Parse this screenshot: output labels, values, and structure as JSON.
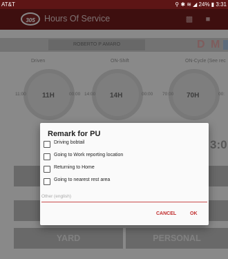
{
  "status_bar": {
    "carrier": "AT&T",
    "system": "⚲ ✱ ≋ ◢ 24% ▮ 3:31"
  },
  "app_bar": {
    "logo_text": "305",
    "title": "Hours Of Service"
  },
  "driver": {
    "name": "ROBERTO P AMARO",
    "status_letters": "D M"
  },
  "gauges": [
    {
      "label": "Driven",
      "value": "11H",
      "left": "11:00",
      "right": "00:00"
    },
    {
      "label": "ON-Shift",
      "value": "14H",
      "left": "14:00",
      "right": "00:00"
    },
    {
      "label": "ON-Cycle (See rec",
      "value": "70H",
      "left": "70:00",
      "right": "00:"
    }
  ],
  "big_time": "3:0",
  "bottom_buttons": {
    "yard": "YARD",
    "personal": "PERSONAL"
  },
  "dialog": {
    "title": "Remark for PU",
    "options": [
      "Driving bobtail",
      "Going to Work reporting location",
      "Returning to Home",
      "Going to nearest rest area"
    ],
    "input_placeholder": "Other (english)",
    "cancel_label": "CANCEL",
    "ok_label": "OK"
  }
}
